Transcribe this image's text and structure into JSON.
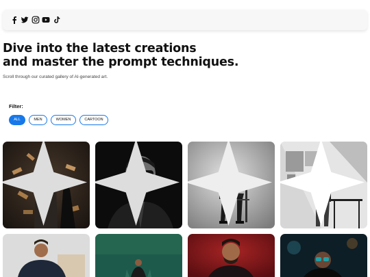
{
  "social": {
    "icons": [
      "facebook-icon",
      "twitter-icon",
      "instagram-icon",
      "youtube-icon",
      "tiktok-icon"
    ]
  },
  "hero": {
    "title_line1": "Dive into the latest creations",
    "title_line2": "and master the prompt techniques.",
    "subtitle": "Scroll through our curated gallery of AI-generated art."
  },
  "filter": {
    "label": "Filter:",
    "options": [
      "ALL",
      "MEN",
      "WOMEN",
      "CARTOON"
    ],
    "selected": "ALL"
  },
  "gallery": {
    "items": [
      {
        "subject": "man-with-floating-books"
      },
      {
        "subject": "man-with-sunglasses-dark"
      },
      {
        "subject": "man-seated-on-chair"
      },
      {
        "subject": "man-leaning-by-window"
      },
      {
        "subject": "man-at-desk"
      },
      {
        "subject": "man-on-green-backdrop"
      },
      {
        "subject": "man-on-red-backdrop"
      },
      {
        "subject": "man-with-glasses-night"
      }
    ]
  },
  "colors": {
    "accent": "#1778ea",
    "bar_bg": "#f7f7f8"
  }
}
